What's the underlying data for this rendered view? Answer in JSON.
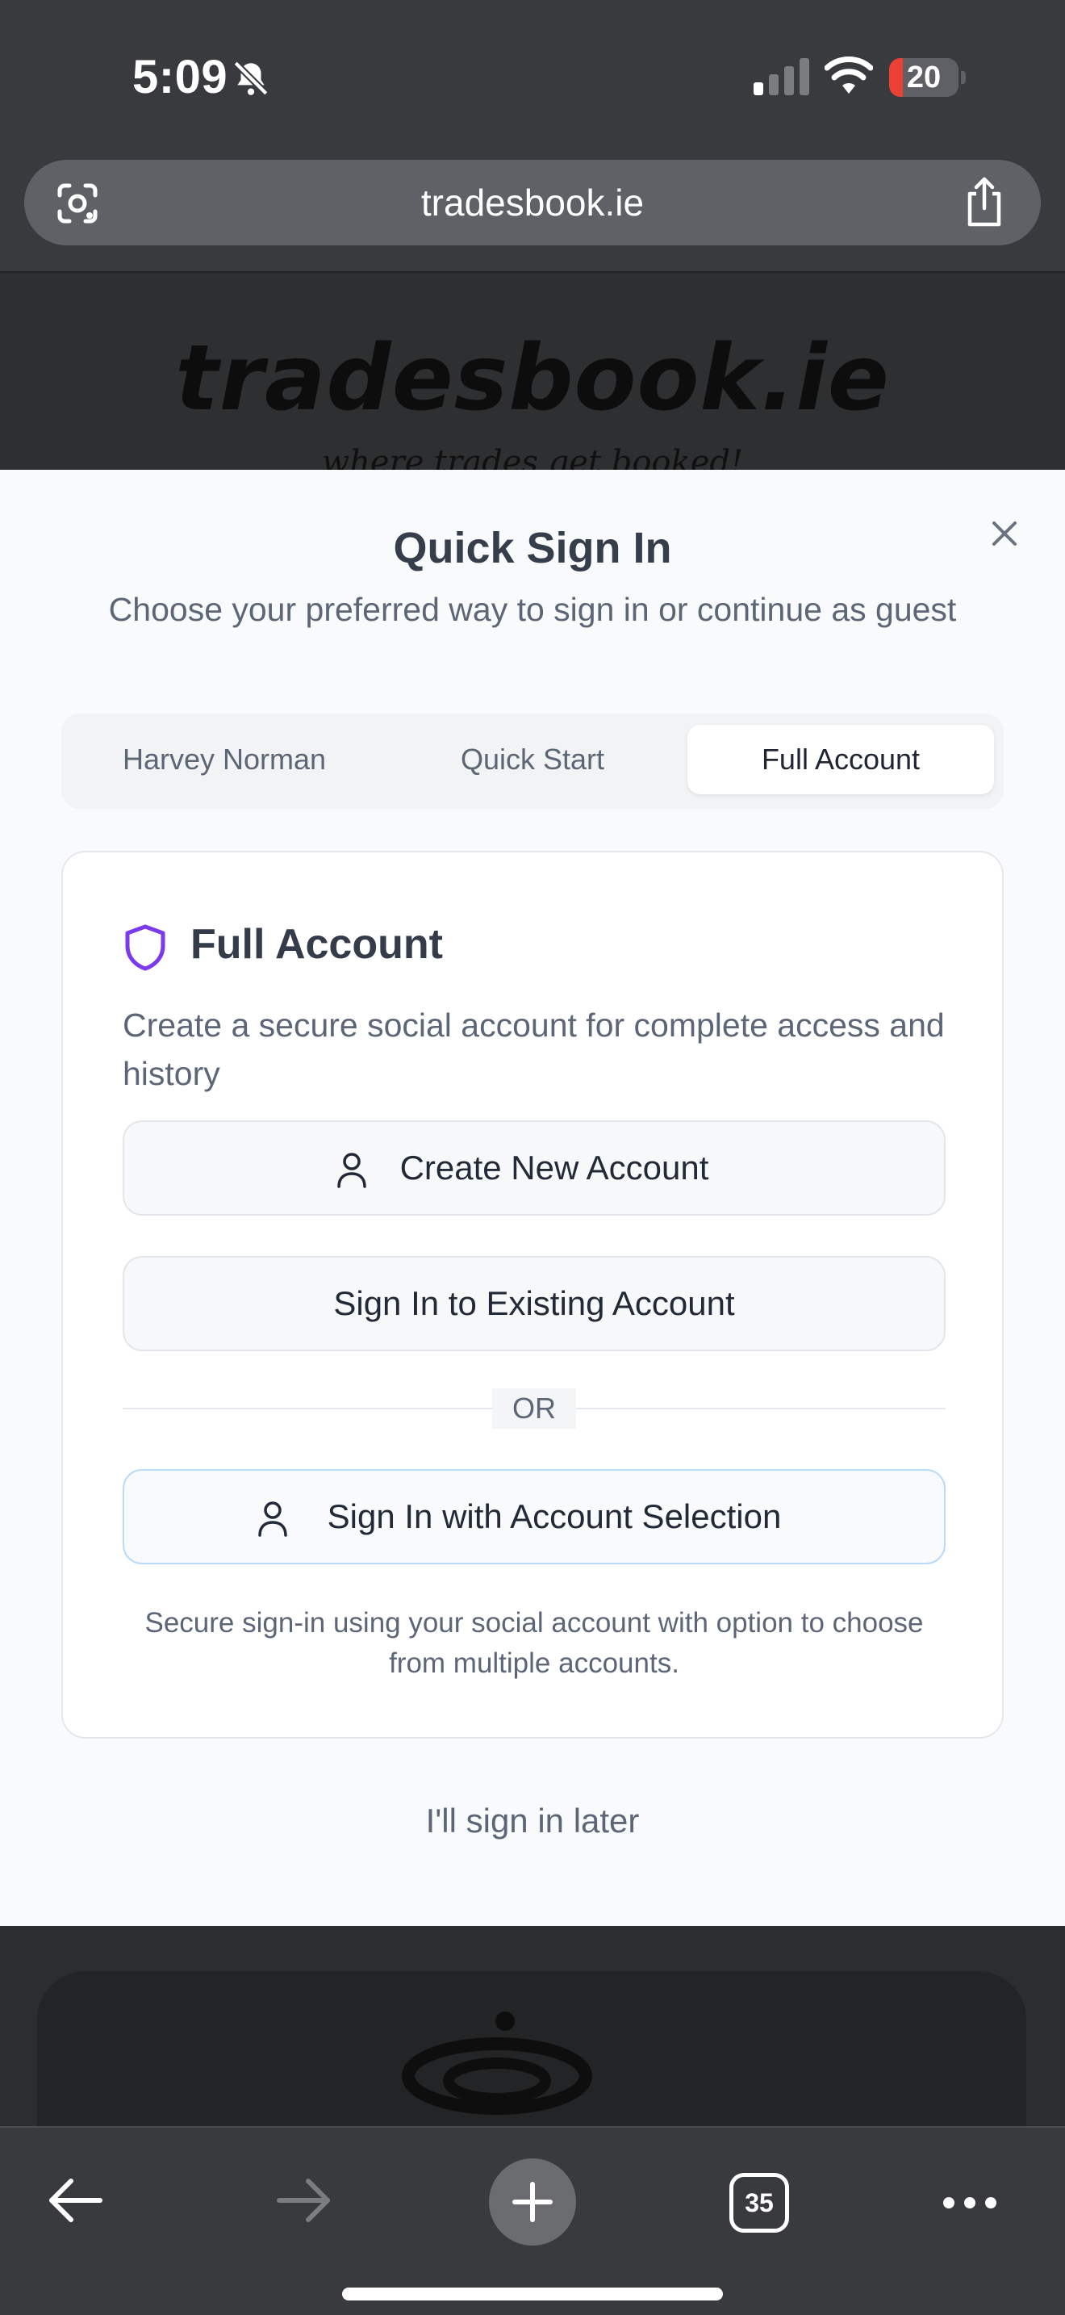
{
  "status_bar": {
    "time": "5:09",
    "battery": "20",
    "battery_level": 0.2,
    "icons": [
      "bell-slash-icon",
      "cellular-signal-icon",
      "wifi-icon",
      "battery-icon"
    ]
  },
  "browser": {
    "url": "tradesbook.ie",
    "icons": [
      "google-lens-icon",
      "share-icon"
    ]
  },
  "site": {
    "logo_text": "tradesbook.ie",
    "tagline": "where trades get booked!"
  },
  "modal": {
    "title": "Quick Sign In",
    "subtitle": "Choose your preferred way to sign in or continue as guest",
    "tabs": [
      {
        "label": "Harvey Norman",
        "active": false
      },
      {
        "label": "Quick Start",
        "active": false
      },
      {
        "label": "Full Account",
        "active": true
      }
    ],
    "card": {
      "title": "Full Account",
      "description": "Create a secure social account for complete access and history",
      "create_button": "Create New Account",
      "signin_button": "Sign In to Existing Account",
      "or_text": "OR",
      "select_button": "Sign In with Account Selection",
      "note": "Secure sign-in using your social account with option to choose from multiple accounts."
    },
    "later_link": "I'll sign in later"
  },
  "toolbar": {
    "tab_count": "35",
    "icons": [
      "back-arrow-icon",
      "forward-arrow-icon",
      "plus-icon",
      "tabs-icon",
      "more-icon"
    ]
  },
  "colors": {
    "accent_purple": "#7c3aed",
    "selection_border": "#b8dcf7",
    "battery_red": "#eb4034"
  }
}
